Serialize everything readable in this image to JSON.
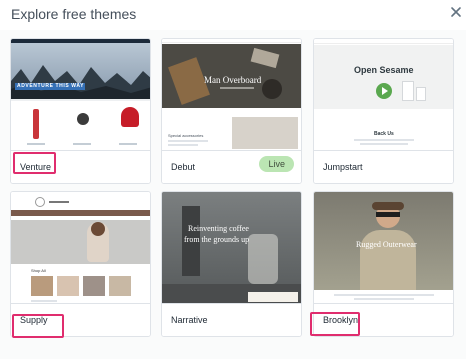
{
  "header": {
    "title": "Explore free themes",
    "close_icon": "close-icon"
  },
  "themes": [
    {
      "name": "Venture",
      "highlighted": true,
      "preview": {
        "banner": "ADVENTURE THIS WAY"
      }
    },
    {
      "name": "Debut",
      "badge": "Live",
      "highlighted": false,
      "preview": {
        "hero_title": "Man Overboard",
        "section_title": "Special accessories"
      }
    },
    {
      "name": "Jumpstart",
      "highlighted": false,
      "preview": {
        "hero_title": "Open Sesame",
        "section_title": "Back Us"
      }
    },
    {
      "name": "Supply",
      "highlighted": true,
      "preview": {
        "section_title": "Shop All"
      }
    },
    {
      "name": "Narrative",
      "highlighted": false,
      "preview": {
        "hero_title_line1": "Reinventing coffee",
        "hero_title_line2": "from the grounds up"
      }
    },
    {
      "name": "Brooklyn",
      "highlighted": true,
      "preview": {
        "hero_title": "Rugged Outerwear"
      }
    }
  ],
  "colors": {
    "highlight": "#e02d6e",
    "live_badge": "#bbe5b3",
    "border": "#dfe3e8"
  }
}
